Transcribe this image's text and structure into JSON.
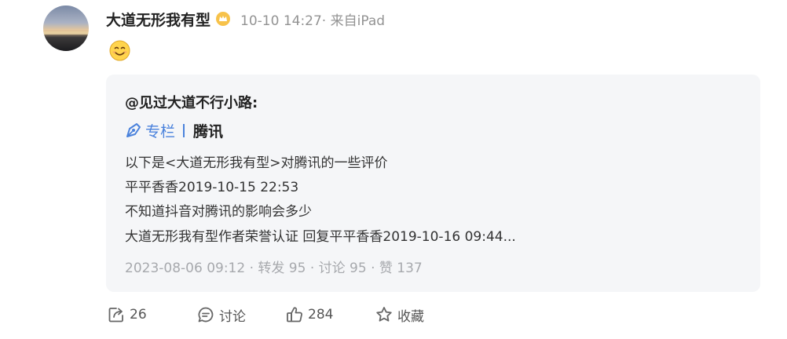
{
  "post": {
    "author_name": "大道无形我有型",
    "badge_icon": "vip-crown-icon",
    "meta": "10-10 14:27· 来自iPad",
    "emoji_icon": "smile-emoji-icon"
  },
  "quoted": {
    "author": "@见过大道不行小路:",
    "column_label": "专栏",
    "column_title": "腾讯",
    "lines": [
      "以下是<大道无形我有型>对腾讯的一些评价",
      "平平香香2019-10-15 22:53",
      "不知道抖音对腾讯的影响会多少",
      "大道无形我有型作者荣誉认证 回复平平香香2019-10-16 09:44..."
    ],
    "stats": "2023-08-06 09:12  · 转发 95 · 讨论 95 · 赞 137"
  },
  "actions": {
    "forward_count": "26",
    "comment_label": "讨论",
    "like_count": "284",
    "collect_label": "收藏"
  },
  "colors": {
    "link": "#4a82dc",
    "card_bg": "#f5f6f8",
    "meta": "#939393"
  }
}
